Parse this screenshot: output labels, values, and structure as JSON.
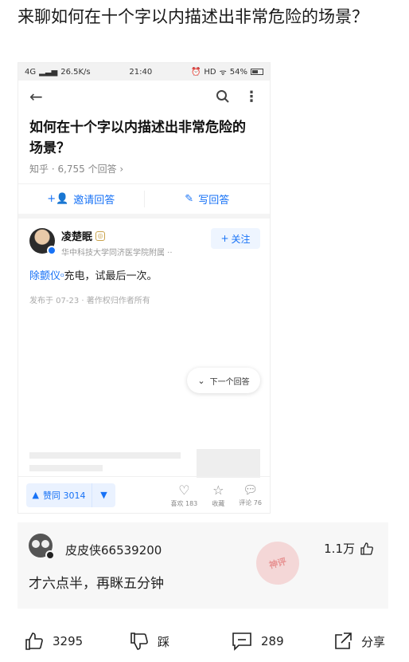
{
  "post": {
    "title": "来聊如何在十个字以内描述出非常危险的场景？"
  },
  "shot": {
    "status": {
      "network": "4G",
      "speed": "26.5K/s",
      "time": "21:40",
      "hd": "HD",
      "battery": "54%"
    },
    "question": {
      "title": "如何在十个字以内描述出非常危险的场景？",
      "meta": "知乎 · 6,755 个回答 ›"
    },
    "actions": {
      "invite": "邀请回答",
      "write": "写回答"
    },
    "author": {
      "name": "凌楚眠",
      "desc": "华中科技大学同济医学院附属 ··",
      "follow": "关注"
    },
    "answer": {
      "keyword": "除颤仪",
      "text": "充电，试最后一次。",
      "published": "发布于 07-23 · 著作权归作者所有"
    },
    "next": "下一个回答",
    "bottom": {
      "upvote": "赞同 3014",
      "like": "喜欢 183",
      "collect": "收藏",
      "comment": "评论 76"
    }
  },
  "comment": {
    "username": "皮皮侠66539200",
    "likes": "1.1万",
    "text": "才六点半，再眯五分钟"
  },
  "actions": {
    "like_count": "3295",
    "dislike": "踩",
    "comment_count": "289",
    "share": "分享"
  }
}
